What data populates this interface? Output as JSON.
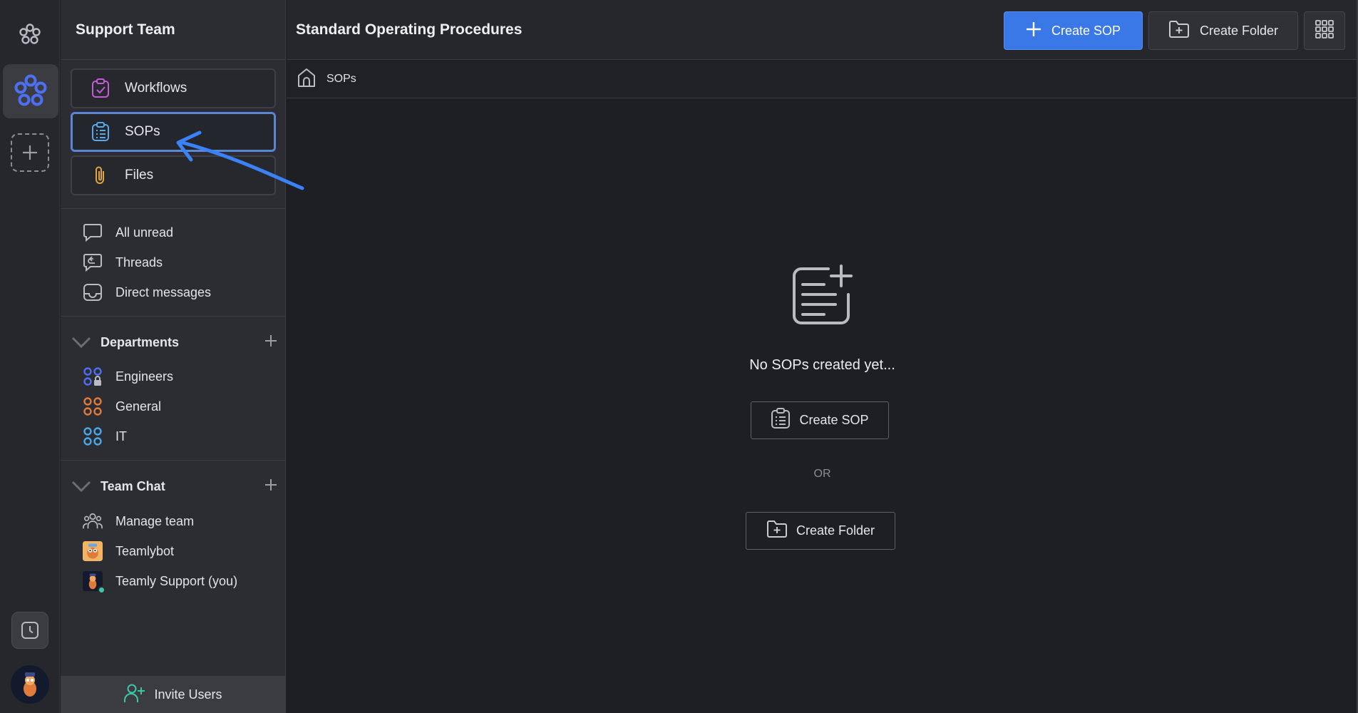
{
  "workspace": {
    "name": "Support Team"
  },
  "nav_cards": [
    {
      "label": "Workflows",
      "icon": "clipboard-check-icon",
      "color": "#c35bd6"
    },
    {
      "label": "SOPs",
      "icon": "clipboard-list-icon",
      "color": "#5aa9e6",
      "selected": true
    },
    {
      "label": "Files",
      "icon": "paperclip-icon",
      "color": "#e0a63d"
    }
  ],
  "inbox_items": [
    {
      "label": "All unread",
      "icon": "chat-bubble-icon"
    },
    {
      "label": "Threads",
      "icon": "threads-icon"
    },
    {
      "label": "Direct messages",
      "icon": "inbox-tray-icon"
    }
  ],
  "departments": {
    "title": "Departments",
    "items": [
      {
        "label": "Engineers",
        "icon": "group-lock-icon",
        "color": "#4d6ff0"
      },
      {
        "label": "General",
        "icon": "group-icon",
        "color": "#e07b3c"
      },
      {
        "label": "IT",
        "icon": "group-icon",
        "color": "#4aa8e6"
      }
    ]
  },
  "team_chat": {
    "title": "Team Chat",
    "items": [
      {
        "label": "Manage team",
        "icon": "team-icon"
      },
      {
        "label": "Teamlybot",
        "icon": "bot-avatar"
      },
      {
        "label": "Teamly Support (you)",
        "icon": "user-avatar"
      }
    ]
  },
  "invite": {
    "label": "Invite Users"
  },
  "header": {
    "title": "Standard Operating Procedures",
    "create_sop": "Create SOP",
    "create_folder": "Create Folder"
  },
  "breadcrumb": {
    "current": "SOPs"
  },
  "empty_state": {
    "message": "No SOPs created yet...",
    "create_sop": "Create SOP",
    "or": "OR",
    "create_folder": "Create Folder"
  },
  "colors": {
    "accent": "#3b78e7",
    "annotation_arrow": "#3b82f6"
  }
}
